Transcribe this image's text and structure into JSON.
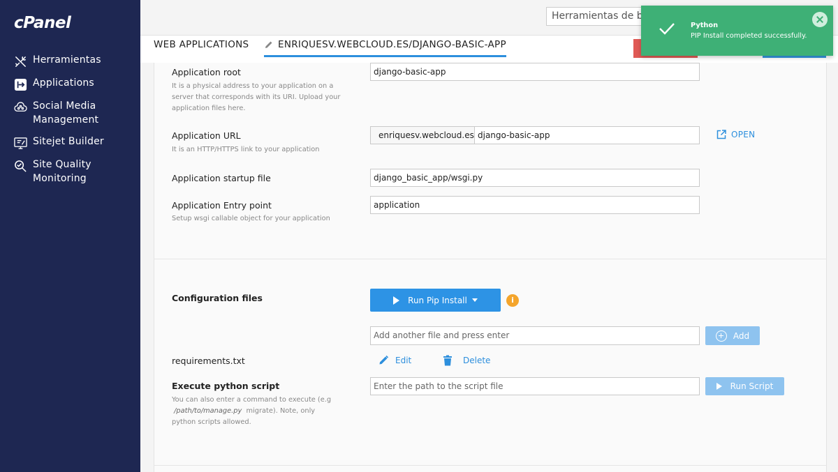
{
  "brand": {
    "logo": "cPanel"
  },
  "sidebar": {
    "items": [
      {
        "label": "Herramientas",
        "icon": "tools-icon"
      },
      {
        "label": "Applications",
        "icon": "applications-icon"
      },
      {
        "label": "Social Media Management",
        "icon": "social-media-icon"
      },
      {
        "label": "Sitejet Builder",
        "icon": "sitejet-builder-icon"
      },
      {
        "label": "Site Quality Monitoring",
        "icon": "site-quality-icon"
      }
    ]
  },
  "header": {
    "search_value": "Herramientas de bús",
    "tab_web_applications": "WEB APPLICATIONS",
    "tab_current_app": "ENRIQUESV.WEBCLOUD.ES/DJANGO-BASIC-APP"
  },
  "toast": {
    "title": "Python",
    "message": "PIP Install completed successfully."
  },
  "form": {
    "app_root": {
      "label": "Application root",
      "help": "It is a physical address to your application on a server that corresponds with its URI. Upload your application files here.",
      "value": "django-basic-app"
    },
    "app_url": {
      "label": "Application URL",
      "help": "It is an HTTP/HTTPS link to your application",
      "domain": "enriquesv.webcloud.es",
      "path": "django-basic-app",
      "open_label": "OPEN"
    },
    "startup_file": {
      "label": "Application startup file",
      "value": "django_basic_app/wsgi.py"
    },
    "entry_point": {
      "label": "Application Entry point",
      "help": "Setup wsgi callable object for your application",
      "value": "application"
    }
  },
  "config": {
    "label": "Configuration files",
    "run_pip_label": "Run Pip Install",
    "info_symbol": "i",
    "add_placeholder": "Add another file and press enter",
    "add_label": "Add",
    "file_name": "requirements.txt",
    "edit_label": "Edit",
    "delete_label": "Delete"
  },
  "script": {
    "label": "Execute python script",
    "help_part1": "You can also enter a command to execute (e.g",
    "help_path": "/path/to/manage.py",
    "help_part2": "migrate). Note, only python scripts allowed.",
    "placeholder": "Enter the path to the script file",
    "run_label": "Run Script"
  },
  "colors": {
    "sidebar_bg": "#1e2752",
    "accent_blue": "#2d93e5",
    "toast_green": "#3eb076",
    "info_orange": "#f4a52c"
  }
}
